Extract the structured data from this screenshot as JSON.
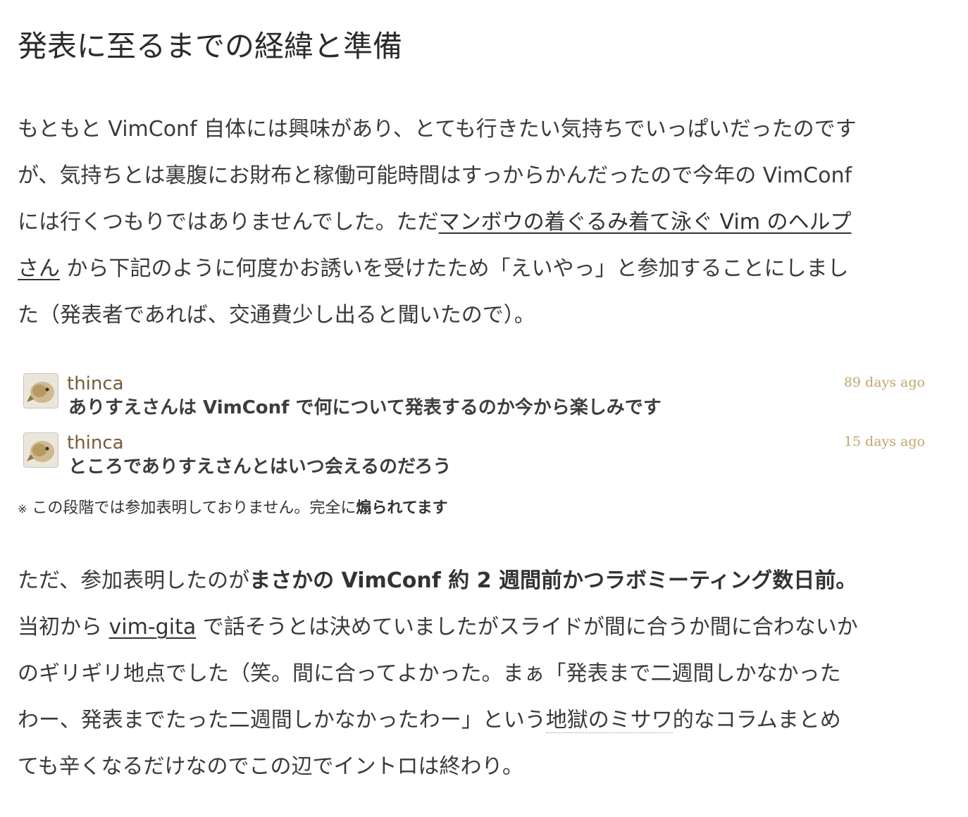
{
  "heading": "発表に至るまでの経緯と準備",
  "para1": {
    "line1": "もともと VimConf 自体には興味があり、とても行きたい気持ちでいっぱいだったのです",
    "line2": "が、気持ちとは裏腹にお財布と稼働可能時間はすっからかんだったので今年の VimConf",
    "line3_before": "には行くつもりではありませんでした。ただ",
    "link_part1": "マンボウの着ぐるみ着て泳ぐ Vim のヘルプ",
    "link_part2": "さん",
    "line4_after": " から下記のように何度かお誘いを受けたため「えいやっ」と参加することにしまし",
    "line5": "た（発表者であれば、交通費少し出ると聞いたので）。"
  },
  "tweets": [
    {
      "user": "thinca",
      "text": "ありすえさんは VimConf で何について発表するのか今から楽しみです",
      "time": "89 days ago"
    },
    {
      "user": "thinca",
      "text": "ところでありすえさんとはいつ会えるのだろう",
      "time": "15 days ago"
    }
  ],
  "note": {
    "mark": "※",
    "text": " この段階では参加表明しておりません。完全に",
    "bold": "煽られてます"
  },
  "para2": {
    "line1_before": "ただ、参加表明したのが",
    "line1_bold": "まさかの VimConf 約 2 週間前かつラボミーティング数日前。",
    "line2_before": "当初から ",
    "link": "vim-gita",
    "line2_after": " で話そうとは決めていましたがスライドが間に合うか間に合わないか",
    "line3": "のギリギリ地点でした（笑。間に合ってよかった。まぁ「発表まで二週間しかなかった",
    "line4_before": "わー、発表までたった二週間しかなかったわー」という",
    "line4_term": "地獄のミサワ",
    "line4_after": "的なコラムまとめ",
    "line5": "ても辛くなるだけなのでこの辺でイントロは終わり。"
  }
}
